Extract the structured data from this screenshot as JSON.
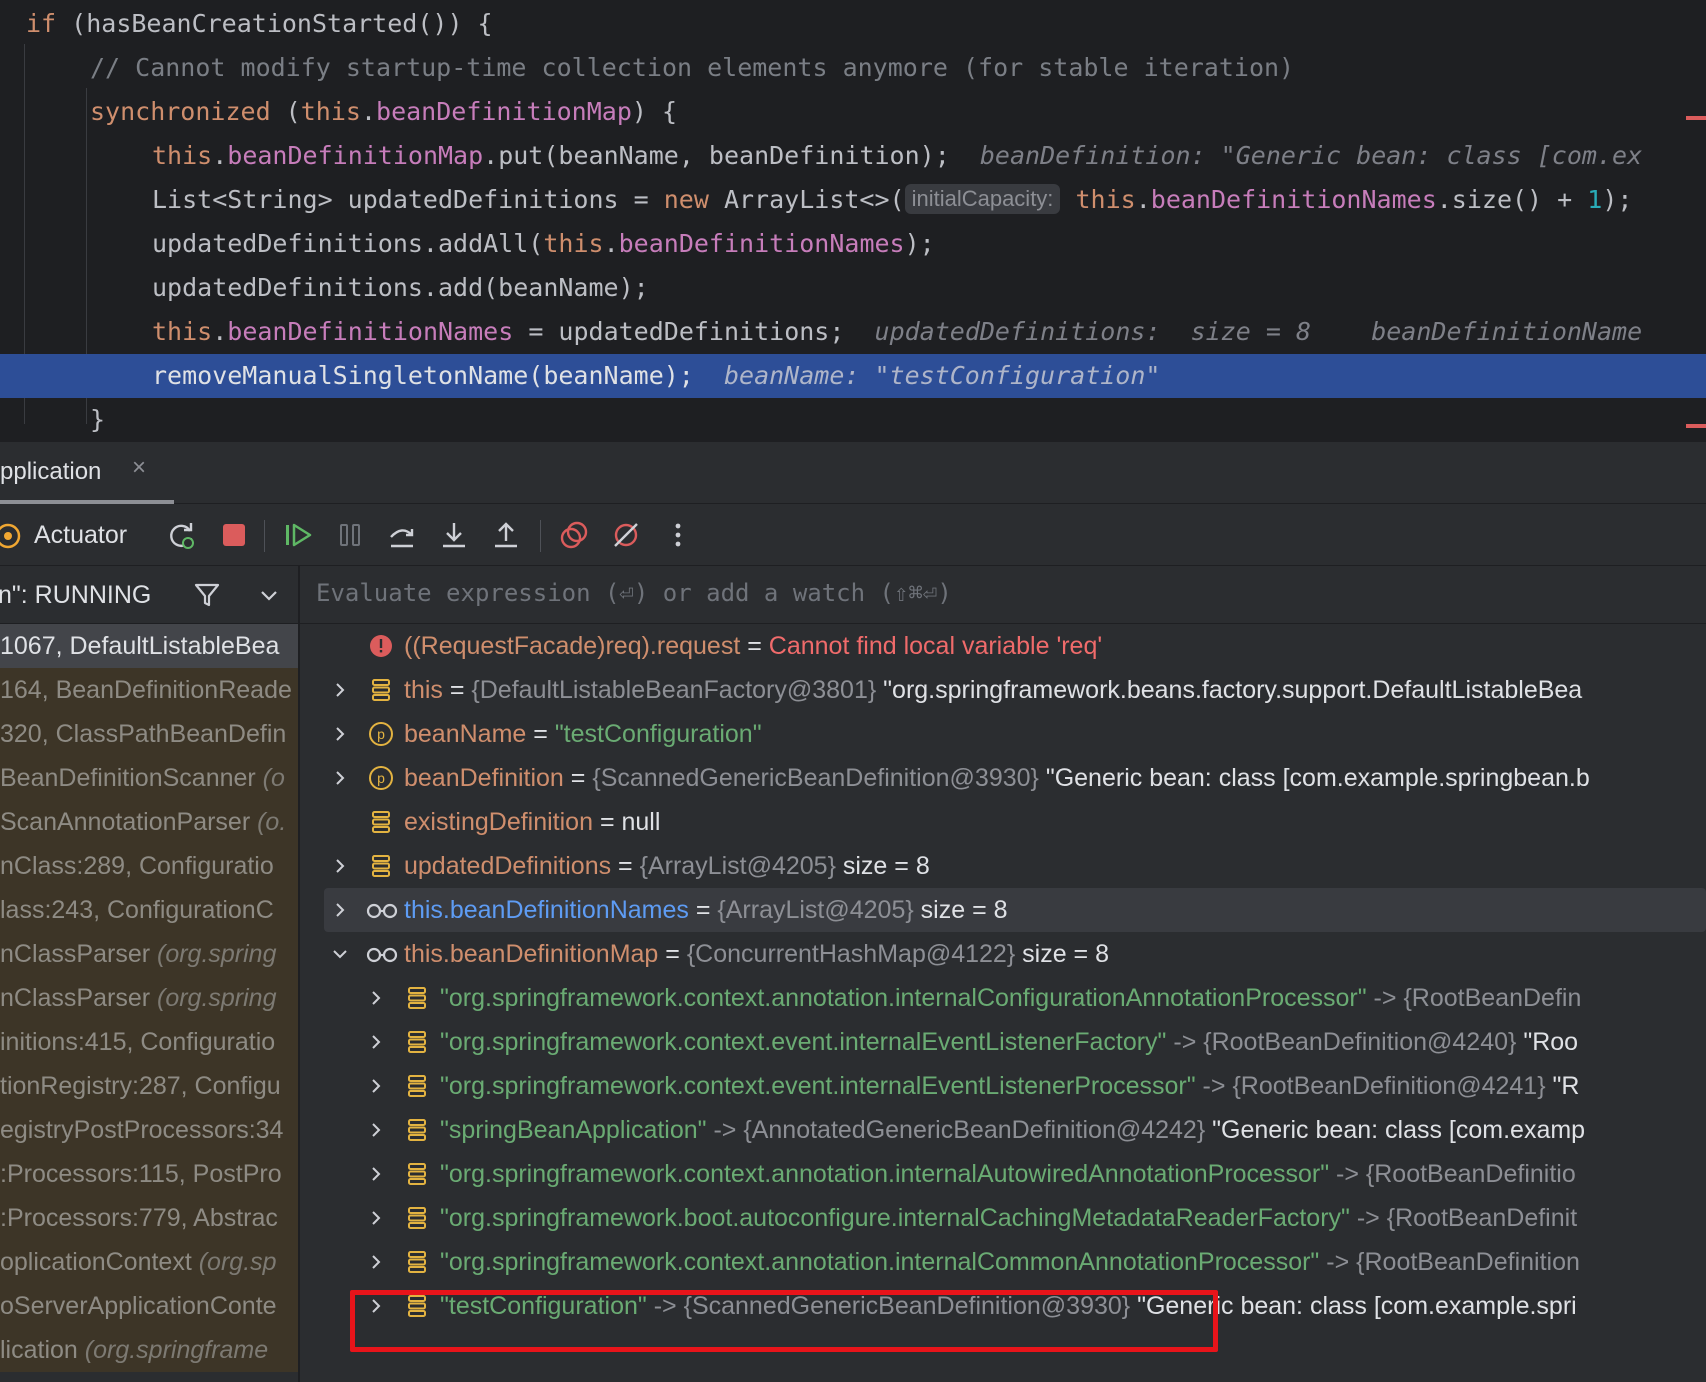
{
  "editor": {
    "lines": {
      "l1": {
        "if": "if",
        "cond": " (hasBeanCreationStarted()) {"
      },
      "l2": {
        "comment": "// Cannot modify startup-time collection elements anymore (for stable iteration)"
      },
      "l3": {
        "kw": "synchronized",
        "p1": " (",
        "this": "this",
        "dot": ".",
        "field": "beanDefinitionMap",
        "p2": ") {"
      },
      "l4": {
        "this": "this",
        "dot": ".",
        "field": "beanDefinitionMap",
        "call": ".put(beanName, beanDefinition);",
        "hint": "beanDefinition: \"Generic bean: class [com.ex"
      },
      "l5": {
        "decl": "List<String> updatedDefinitions = ",
        "new": "new",
        "ctor": " ArrayList<>(",
        "param": "initialCapacity:",
        "this": "this",
        "dot": ".",
        "field": "beanDefinitionNames",
        "call": ".size() + ",
        "num": "1",
        "end": ");"
      },
      "l6": {
        "pre": "updatedDefinitions.addAll(",
        "this": "this",
        "dot": ".",
        "field": "beanDefinitionNames",
        "end": ");"
      },
      "l7": {
        "text": "updatedDefinitions.add(beanName);"
      },
      "l8": {
        "this": "this",
        "dot": ".",
        "field": "beanDefinitionNames",
        "rest": " = updatedDefinitions;",
        "hint": "updatedDefinitions:  size = 8    beanDefinitionName"
      },
      "l9": {
        "text": "removeManualSingletonName(beanName);",
        "hint": "beanName: \"testConfiguration\""
      },
      "l10": {
        "text": "}"
      }
    }
  },
  "debug": {
    "tab_label": "pplication",
    "close_glyph": "×",
    "config_label": "Actuator",
    "thread_label": "n\": RUNNING",
    "eval_placeholder": "Evaluate expression (⏎) or add a watch (⇧⌘⏎)",
    "frames": [
      {
        "text": "1067, DefaultListableBea",
        "pkg": "",
        "kind": "selected"
      },
      {
        "text": "164, BeanDefinitionReade",
        "pkg": "",
        "kind": "lib"
      },
      {
        "text": "320, ClassPathBeanDefin",
        "pkg": "",
        "kind": "lib"
      },
      {
        "text": "BeanDefinitionScanner ",
        "pkg": "(o",
        "kind": "lib"
      },
      {
        "text": "ScanAnnotationParser ",
        "pkg": "(o.",
        "kind": "lib"
      },
      {
        "text": "nClass:289, Configuratio",
        "pkg": "",
        "kind": "lib"
      },
      {
        "text": "lass:243, ConfigurationC",
        "pkg": "",
        "kind": "lib"
      },
      {
        "text": "nClassParser ",
        "pkg": "(org.spring",
        "kind": "lib"
      },
      {
        "text": "nClassParser ",
        "pkg": "(org.spring",
        "kind": "lib"
      },
      {
        "text": "initions:415, Configuratio",
        "pkg": "",
        "kind": "lib"
      },
      {
        "text": "tionRegistry:287, Configu",
        "pkg": "",
        "kind": "lib"
      },
      {
        "text": "egistryPostProcessors:34",
        "pkg": "",
        "kind": "lib"
      },
      {
        "text": ":Processors:115, PostPro",
        "pkg": "",
        "kind": "lib"
      },
      {
        "text": ":Processors:779, Abstrac",
        "pkg": "",
        "kind": "lib"
      },
      {
        "text": "oplicationContext ",
        "pkg": "(org.sp",
        "kind": "lib"
      },
      {
        "text": "oServerApplicationConte",
        "pkg": "",
        "kind": "lib"
      },
      {
        "text": "lication ",
        "pkg": "(org.springframe",
        "kind": "lib"
      }
    ],
    "vars": {
      "err": {
        "name": "((RequestFacade)req).request",
        "eq": " = ",
        "value": "Cannot find local variable 'req'"
      },
      "this": {
        "name": "this",
        "eq": " = ",
        "ref": "{DefaultListableBeanFactory@3801}",
        "value": " \"org.springframework.beans.factory.support.DefaultListableBea"
      },
      "beanName": {
        "name": "beanName",
        "eq": " = ",
        "value": "\"testConfiguration\""
      },
      "beanDefinition": {
        "name": "beanDefinition",
        "eq": " = ",
        "ref": "{ScannedGenericBeanDefinition@3930}",
        "value": " \"Generic bean: class [com.example.springbean.b"
      },
      "existingDefinition": {
        "name": "existingDefinition",
        "eq": " = ",
        "value": "null"
      },
      "updatedDefinitions": {
        "name": "updatedDefinitions",
        "eq": " = ",
        "ref": "{ArrayList@4205}",
        "value": "  size = 8"
      },
      "watchNames": {
        "name": "this.beanDefinitionNames",
        "eq": " = ",
        "ref": "{ArrayList@4205}",
        "value": "  size = 8"
      },
      "watchMap": {
        "name": "this.beanDefinitionMap",
        "eq": " = ",
        "ref": "{ConcurrentHashMap@4122}",
        "value": "  size = 8"
      }
    },
    "map_entries": [
      {
        "key": "\"org.springframework.context.annotation.internalConfigurationAnnotationProcessor\"",
        "arrow": " -> ",
        "ref": "{RootBeanDefin",
        "value": ""
      },
      {
        "key": "\"org.springframework.context.event.internalEventListenerFactory\"",
        "arrow": " -> ",
        "ref": "{RootBeanDefinition@4240}",
        "value": " \"Roo"
      },
      {
        "key": "\"org.springframework.context.event.internalEventListenerProcessor\"",
        "arrow": " -> ",
        "ref": "{RootBeanDefinition@4241}",
        "value": " \"R"
      },
      {
        "key": "\"springBeanApplication\"",
        "arrow": " -> ",
        "ref": "{AnnotatedGenericBeanDefinition@4242}",
        "value": " \"Generic bean: class [com.examp"
      },
      {
        "key": "\"org.springframework.context.annotation.internalAutowiredAnnotationProcessor\"",
        "arrow": " -> ",
        "ref": "{RootBeanDefinitio",
        "value": ""
      },
      {
        "key": "\"org.springframework.boot.autoconfigure.internalCachingMetadataReaderFactory\"",
        "arrow": " -> ",
        "ref": "{RootBeanDefinit",
        "value": ""
      },
      {
        "key": "\"org.springframework.context.annotation.internalCommonAnnotationProcessor\"",
        "arrow": " -> ",
        "ref": "{RootBeanDefinition",
        "value": ""
      },
      {
        "key": "\"testConfiguration\"",
        "arrow": " -> ",
        "ref": "{ScannedGenericBeanDefinition@3930}",
        "value": " \"Generic bean: class [com.example.spri"
      }
    ]
  },
  "colors": {
    "highlight_box": "#e8141a",
    "current_line": "#2d4e97",
    "library_frame": "#3d3527"
  }
}
